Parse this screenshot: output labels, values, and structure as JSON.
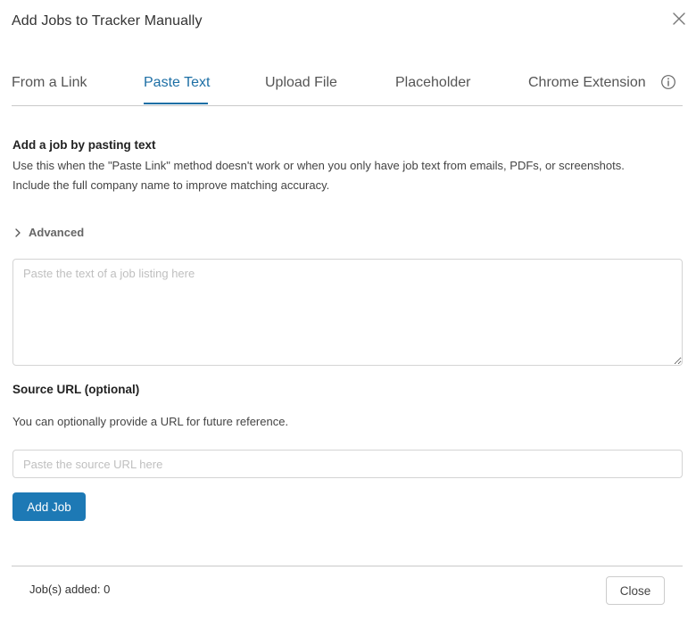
{
  "modal": {
    "title": "Add Jobs to Tracker Manually"
  },
  "tabs": [
    {
      "label": "From a Link",
      "active": false
    },
    {
      "label": "Paste Text",
      "active": true
    },
    {
      "label": "Upload File",
      "active": false
    },
    {
      "label": "Placeholder",
      "active": false
    },
    {
      "label": "Chrome Extension",
      "active": false
    }
  ],
  "paste_section": {
    "heading": "Add a job by pasting text",
    "description_line1": "Use this when the \"Paste Link\" method doesn't work or when you only have job text from emails, PDFs, or screenshots.",
    "description_line2": "Include the full company name to improve matching accuracy.",
    "advanced_label": "Advanced",
    "textarea_value": "",
    "textarea_placeholder": "Paste the text of a job listing here"
  },
  "source_url": {
    "label": "Source URL (optional)",
    "help_text": "You can optionally provide a URL for future reference.",
    "value": "",
    "placeholder": "Paste the source URL here"
  },
  "actions": {
    "add_job_label": "Add Job",
    "close_label": "Close"
  },
  "footer": {
    "jobs_added_text": "Job(s) added: 0"
  },
  "icons": {
    "close": "close-icon",
    "info": "info-icon",
    "chevron": "chevron-right-icon"
  },
  "colors": {
    "accent": "#1d6fa5",
    "button_primary": "#1d79b5",
    "text_primary": "#333333",
    "border": "#d4d4d4"
  }
}
